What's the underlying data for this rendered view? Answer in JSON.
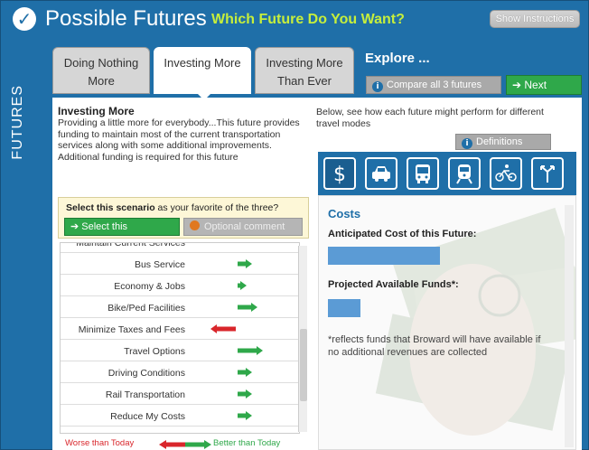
{
  "header": {
    "title": "Possible Futures",
    "subtitle": "Which Future Do You Want?",
    "instructions_button": "Show Instructions"
  },
  "side_tab": {
    "label": "FUTURES"
  },
  "tabs": [
    {
      "label_line1": "Doing Nothing",
      "label_line2": "More",
      "active": false
    },
    {
      "label_line1": "Investing More",
      "label_line2": "",
      "active": true
    },
    {
      "label_line1": "Investing More",
      "label_line2": "Than Ever",
      "active": false
    }
  ],
  "explore": {
    "title": "Explore ...",
    "compare_button": "Compare all 3 futures",
    "next_button": "Next"
  },
  "scenario": {
    "title": "Investing More",
    "description": "Providing a little more for everybody...This future provides funding to maintain most of the current transportation services along with some additional improvements. Additional funding is required for this future"
  },
  "select_box": {
    "prompt_bold": "Select this scenario",
    "prompt_rest": " as your favorite of the three?",
    "select_button": "Select this",
    "comment_button": "Optional comment"
  },
  "outcomes": {
    "partial_top_row": "Maintain Current Services",
    "rows": [
      {
        "label": "Bus Service",
        "direction": "better",
        "magnitude": 1
      },
      {
        "label": "Economy & Jobs",
        "direction": "better",
        "magnitude": 0.5
      },
      {
        "label": "Bike/Ped Facilities",
        "direction": "better",
        "magnitude": 1.5
      },
      {
        "label": "Minimize Taxes and Fees",
        "direction": "worse",
        "magnitude": 2
      },
      {
        "label": "Travel Options",
        "direction": "better",
        "magnitude": 2
      },
      {
        "label": "Driving Conditions",
        "direction": "better",
        "magnitude": 1
      },
      {
        "label": "Rail Transportation",
        "direction": "better",
        "magnitude": 1
      },
      {
        "label": "Reduce My Costs",
        "direction": "better",
        "magnitude": 1
      }
    ]
  },
  "legend": {
    "worse": "Worse than Today",
    "better": "Better than Today",
    "worse_color": "#d9262b",
    "better_color": "#2fa84a"
  },
  "right": {
    "intro": "Below, see how each future might perform for different travel modes",
    "definitions_button": "Definitions",
    "modes": [
      "dollar-icon",
      "car-icon",
      "bus-icon",
      "train-icon",
      "bike-icon",
      "walk-icon"
    ],
    "costs_title": "Costs",
    "cost_label": "Anticipated Cost of this Future:",
    "funds_label": "Projected Available Funds*:",
    "note": "*reflects funds that Broward will have available if no additional revenues are collected"
  }
}
